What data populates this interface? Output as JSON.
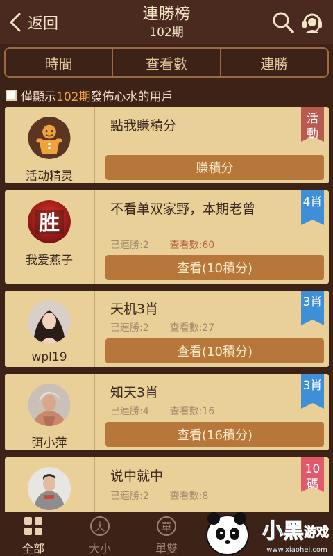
{
  "header": {
    "back_label": "返回",
    "title": "連勝榜",
    "subtitle": "102期"
  },
  "tabs": [
    {
      "label": "時間"
    },
    {
      "label": "查看數"
    },
    {
      "label": "連勝"
    }
  ],
  "filter": {
    "prefix": "僅顯示",
    "period": "102期",
    "suffix": "發佈心水的用戶",
    "checked": false
  },
  "cards": [
    {
      "username": "活动精灵",
      "headline": "點我賺積分",
      "action_label": "賺積分",
      "ribbon": "活動",
      "ribbon_color": "#b95a4f",
      "avatar": "gingerbread-avatar"
    },
    {
      "username": "我爱燕子",
      "headline": "不看单双家野，本期老曾",
      "streak_label": "已連勝:2",
      "views_label": "查看數:60",
      "action_label": "查看(10積分)",
      "ribbon": "4肖",
      "ribbon_color": "#3f8fd8",
      "avatar": "sheng-character-avatar"
    },
    {
      "username": "wpl19",
      "headline": "天机3肖",
      "streak_label": "已連勝:2",
      "views_label": "查看數:27",
      "action_label": "查看(10積分)",
      "ribbon": "3肖",
      "ribbon_color": "#3f8fd8",
      "avatar": "photo-avatar"
    },
    {
      "username": "弭小萍",
      "headline": "知天3肖",
      "streak_label": "已連勝:4",
      "views_label": "查看數:16",
      "action_label": "查看(16積分)",
      "ribbon": "3肖",
      "ribbon_color": "#3f8fd8",
      "avatar": "photo-avatar"
    },
    {
      "username": "",
      "headline": "说中就中",
      "streak_label": "已連勝:2",
      "views_label": "查看數:8",
      "action_label": "",
      "ribbon": "10碼",
      "ribbon_color": "#e05a6c",
      "avatar": "photo-avatar"
    }
  ],
  "bottom_nav": [
    {
      "label": "全部",
      "icon": "grid-icon",
      "active": true
    },
    {
      "label": "大小",
      "icon": "da-circle-icon",
      "active": false
    },
    {
      "label": "單雙",
      "icon": "dan-circle-icon",
      "active": false
    }
  ],
  "watermark": {
    "brand": "小黑游戏",
    "url": "www.xiaohei.com"
  }
}
